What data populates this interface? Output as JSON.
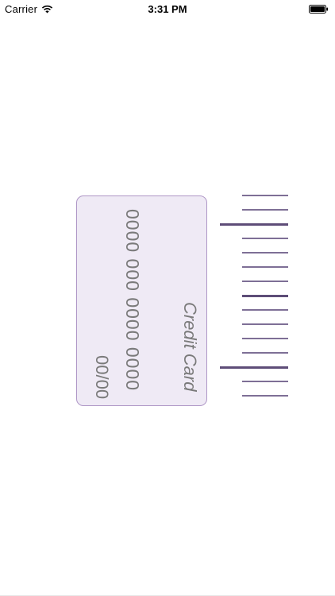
{
  "status_bar": {
    "carrier": "Carrier",
    "time": "3:31 PM",
    "wifi_icon": "wifi-icon",
    "battery_icon": "battery-icon"
  },
  "card": {
    "number": "0000 000 0000 0000",
    "label": "Credit Card",
    "expiry": "00/00",
    "background_color": "#efeaf5",
    "border_color": "#ae96c6"
  },
  "ruler": {
    "tick_color": "#5e4d78",
    "ticks": [
      "minor",
      "minor",
      "major",
      "minor",
      "minor",
      "minor",
      "minor",
      "mid",
      "minor",
      "minor",
      "minor",
      "minor",
      "major",
      "minor",
      "minor"
    ]
  }
}
